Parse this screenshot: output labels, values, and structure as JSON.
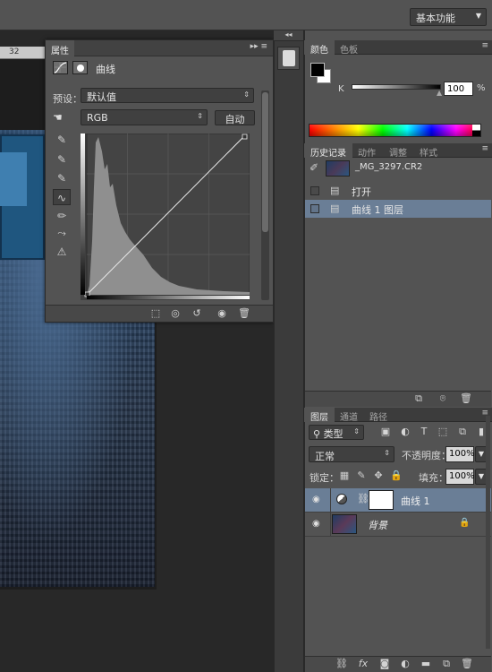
{
  "topbar": {
    "workspace": "基本功能"
  },
  "ruler": {
    "tick_label": "32"
  },
  "properties_panel": {
    "tab": "属性",
    "title": "曲线",
    "preset_label": "预设：",
    "preset_value": "默认值",
    "channel_value": "RGB",
    "auto_label": "自动"
  },
  "color_panel": {
    "tabs": [
      "颜色",
      "色板"
    ],
    "channel_label": "K",
    "channel_value": "100",
    "percent": "%"
  },
  "history_panel": {
    "tabs": [
      "历史记录",
      "动作",
      "调整",
      "样式"
    ],
    "snapshot": "_MG_3297.CR2",
    "items": [
      "打开",
      "曲线 1 图层"
    ]
  },
  "layers_panel": {
    "tabs": [
      "图层",
      "通道",
      "路径"
    ],
    "kind_filter": "类型",
    "blend_mode": "正常",
    "opacity_label": "不透明度：",
    "opacity_value": "100%",
    "lock_label": "锁定：",
    "fill_label": "填充：",
    "fill_value": "100%",
    "layers": [
      {
        "name": "曲线 1"
      },
      {
        "name": "背景"
      }
    ]
  },
  "colors": {
    "selection_highlight": "#6a7e96",
    "panel_bg": "#535353",
    "workspace_bg": "#282828"
  }
}
